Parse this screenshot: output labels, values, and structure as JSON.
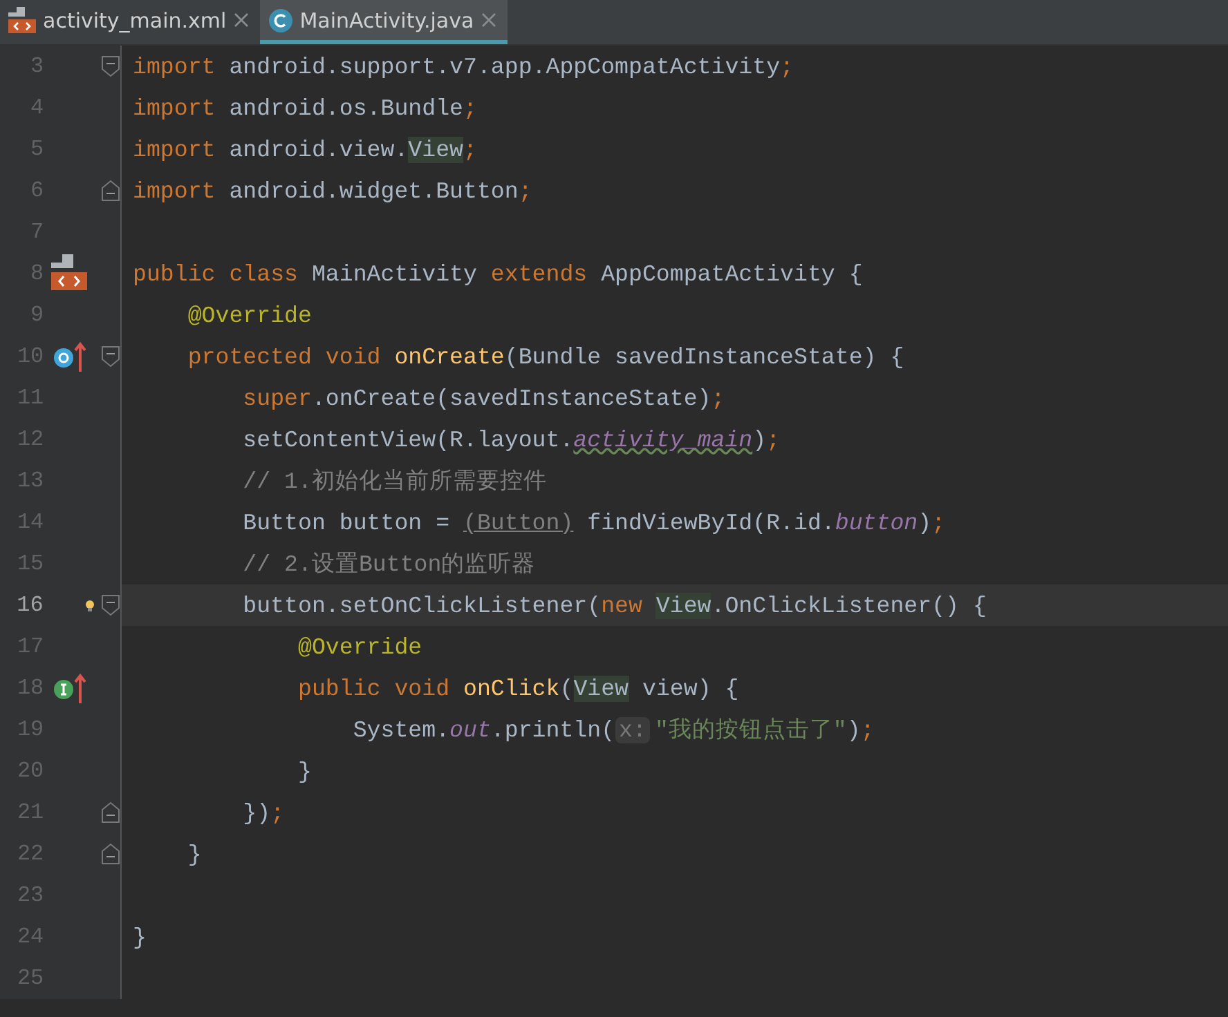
{
  "tabs": [
    {
      "label": "activity_main.xml",
      "kind": "xml",
      "selected": false
    },
    {
      "label": "MainActivity.java",
      "kind": "class",
      "selected": true
    }
  ],
  "editor": {
    "lines": [
      {
        "number": "3",
        "current": false,
        "fold": {
          "kind": "start"
        },
        "tokens": [
          {
            "kind": "kw",
            "t": "import "
          },
          {
            "kind": "plain",
            "t": "android.support.v7.app.AppCompatActivity"
          },
          {
            "kind": "kw",
            "t": ";"
          }
        ]
      },
      {
        "number": "4",
        "current": false,
        "tokens": [
          {
            "kind": "kw",
            "t": "import "
          },
          {
            "kind": "plain",
            "t": "android.os.Bundle"
          },
          {
            "kind": "kw",
            "t": ";"
          }
        ]
      },
      {
        "number": "5",
        "current": false,
        "tokens": [
          {
            "kind": "kw",
            "t": "import "
          },
          {
            "kind": "plain",
            "t": "android.view."
          },
          {
            "kind": "hl",
            "t": "View"
          },
          {
            "kind": "kw",
            "t": ";"
          }
        ]
      },
      {
        "number": "6",
        "current": false,
        "fold": {
          "kind": "end"
        },
        "tokens": [
          {
            "kind": "kw",
            "t": "import "
          },
          {
            "kind": "plain",
            "t": "android.widget.Button"
          },
          {
            "kind": "kw",
            "t": ";"
          }
        ]
      },
      {
        "number": "7",
        "current": false
      },
      {
        "number": "8",
        "current": false,
        "marker": {
          "kind": "class"
        },
        "tokens": [
          {
            "kind": "kw",
            "t": "public class "
          },
          {
            "kind": "plain",
            "t": "MainActivity "
          },
          {
            "kind": "kw",
            "t": "extends "
          },
          {
            "kind": "plain",
            "t": "AppCompatActivity {"
          }
        ]
      },
      {
        "number": "9",
        "current": false,
        "tokens": [
          {
            "kind": "ann",
            "t": "    @Override"
          }
        ]
      },
      {
        "number": "10",
        "current": false,
        "marker": {
          "kind": "override"
        },
        "fold": {
          "kind": "start"
        },
        "tokens": [
          {
            "kind": "kw",
            "t": "    protected void "
          },
          {
            "kind": "decl",
            "t": "onCreate"
          },
          {
            "kind": "plain",
            "t": "(Bundle savedInstanceState) {"
          }
        ]
      },
      {
        "number": "11",
        "current": false,
        "tokens": [
          {
            "kind": "kw",
            "t": "        super"
          },
          {
            "kind": "plain",
            "t": ".onCreate(savedInstanceState)"
          },
          {
            "kind": "kw",
            "t": ";"
          }
        ]
      },
      {
        "number": "12",
        "current": false,
        "tokens": [
          {
            "kind": "plain",
            "t": "        setContentView(R.layout."
          },
          {
            "kind": "typo",
            "t": "activity_main"
          },
          {
            "kind": "plain",
            "t": ")"
          },
          {
            "kind": "kw",
            "t": ";"
          }
        ]
      },
      {
        "number": "13",
        "current": false,
        "tokens": [
          {
            "kind": "comment",
            "t": "        // 1.初始化当前所需要控件"
          }
        ]
      },
      {
        "number": "14",
        "current": false,
        "tokens": [
          {
            "kind": "plain",
            "t": "        Button button = "
          },
          {
            "kind": "redundant",
            "t": "(Button)"
          },
          {
            "kind": "plain",
            "t": " findViewById(R.id."
          },
          {
            "kind": "field",
            "t": "button"
          },
          {
            "kind": "plain",
            "t": ")"
          },
          {
            "kind": "kw",
            "t": ";"
          }
        ]
      },
      {
        "number": "15",
        "current": false,
        "tokens": [
          {
            "kind": "comment",
            "t": "        // 2.设置Button的监听器"
          }
        ]
      },
      {
        "number": "16",
        "current": true,
        "marker": {
          "kind": "bulb"
        },
        "fold": {
          "kind": "start"
        },
        "tokens": [
          {
            "kind": "plain",
            "t": "        button.setOnClickListener("
          },
          {
            "kind": "kw",
            "t": "new "
          },
          {
            "kind": "hl",
            "t": "View"
          },
          {
            "kind": "plain",
            "t": ".OnClickListener() {"
          }
        ]
      },
      {
        "number": "17",
        "current": false,
        "tokens": [
          {
            "kind": "ann",
            "t": "            @Override"
          }
        ]
      },
      {
        "number": "18",
        "current": false,
        "marker": {
          "kind": "implement"
        },
        "tokens": [
          {
            "kind": "kw",
            "t": "            public void "
          },
          {
            "kind": "decl",
            "t": "onClick"
          },
          {
            "kind": "plain",
            "t": "("
          },
          {
            "kind": "hl",
            "t": "View"
          },
          {
            "kind": "plain",
            "t": " view) {"
          }
        ]
      },
      {
        "number": "19",
        "current": false,
        "tokens": [
          {
            "kind": "plain",
            "t": "                System."
          },
          {
            "kind": "field",
            "t": "out"
          },
          {
            "kind": "plain",
            "t": ".println("
          },
          {
            "kind": "hint",
            "t": "x:"
          },
          {
            "kind": "string",
            "t": "\"我的按钮点击了\""
          },
          {
            "kind": "plain",
            "t": ")"
          },
          {
            "kind": "kw",
            "t": ";"
          }
        ]
      },
      {
        "number": "20",
        "current": false,
        "tokens": [
          {
            "kind": "plain",
            "t": "            }"
          }
        ]
      },
      {
        "number": "21",
        "current": false,
        "fold": {
          "kind": "end"
        },
        "tokens": [
          {
            "kind": "plain",
            "t": "        })"
          },
          {
            "kind": "kw",
            "t": ";"
          }
        ]
      },
      {
        "number": "22",
        "current": false,
        "fold": {
          "kind": "end"
        },
        "tokens": [
          {
            "kind": "plain",
            "t": "    }"
          }
        ]
      },
      {
        "number": "23",
        "current": false
      },
      {
        "number": "24",
        "current": false,
        "tokens": [
          {
            "kind": "plain",
            "t": "}"
          }
        ]
      },
      {
        "number": "25",
        "current": false
      }
    ]
  }
}
